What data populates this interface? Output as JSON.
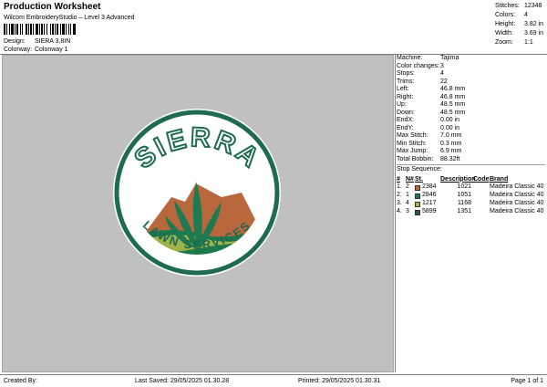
{
  "header": {
    "title": "Production Worksheet",
    "subtitle": "Wilcom EmbroideryStudio – Level 3 Advanced",
    "design_label": "Design:",
    "design_value": "SIERA 3,8IN",
    "colorway_label": "Colorway:",
    "colorway_value": "Colonway 1"
  },
  "stats": [
    {
      "k": "Stitches:",
      "v": "12348"
    },
    {
      "k": "Colors:",
      "v": "4"
    },
    {
      "k": "Height:",
      "v": "3.82 in"
    },
    {
      "k": "Width:",
      "v": "3.69 in"
    },
    {
      "k": "Zoom:",
      "v": "1:1"
    }
  ],
  "machine_info": [
    {
      "k": "Machine:",
      "v": "Tajima"
    },
    {
      "k": "Color changes:",
      "v": "3"
    },
    {
      "k": "Stops:",
      "v": "4"
    },
    {
      "k": "Trims:",
      "v": "22"
    },
    {
      "k": "Left:",
      "v": "46.8 mm"
    },
    {
      "k": "Right:",
      "v": "46.8 mm"
    },
    {
      "k": "Up:",
      "v": "48.5 mm"
    },
    {
      "k": "Down:",
      "v": "48.5 mm"
    },
    {
      "k": "EndX:",
      "v": "0.00 in"
    },
    {
      "k": "EndY:",
      "v": "0.00 in"
    },
    {
      "k": "Max Stitch:",
      "v": "7.0 mm"
    },
    {
      "k": "Min Stitch:",
      "v": "0.3 mm"
    },
    {
      "k": "Max Jump:",
      "v": "6.9 mm"
    },
    {
      "k": "Total Bobbin:",
      "v": "88.32ft"
    }
  ],
  "stop_sequence": {
    "title": "Stop Sequence:",
    "headers": [
      "#",
      "N#",
      "St.",
      "Description",
      "Code",
      "Brand"
    ],
    "rows": [
      {
        "num": "1.",
        "n": "2",
        "color": "#b9683d",
        "desc": "2384",
        "code": "1021",
        "brand": "Madeira Classic 40"
      },
      {
        "num": "2.",
        "n": "1",
        "color": "#1d7a4e",
        "desc": "2846",
        "code": "1051",
        "brand": "Madeira Classic 40"
      },
      {
        "num": "3.",
        "n": "4",
        "color": "#9fb34a",
        "desc": "1217",
        "code": "1168",
        "brand": "Madeira Classic 40"
      },
      {
        "num": "4.",
        "n": "3",
        "color": "#1e5e49",
        "desc": "5899",
        "code": "1351",
        "brand": "Madeira Classic 40"
      }
    ]
  },
  "design": {
    "logo_top_text": "SIERRA",
    "logo_bottom_text": "LAWN SERVICES",
    "colors": {
      "background": "#c0c0c0",
      "ring_green": "#1e6b4f",
      "badge_fill": "#ffffff",
      "mountain": "#b9683d",
      "hill_light": "#9fb34a",
      "hill_dark": "#1d7a4e",
      "leaf": "#1e7a50"
    }
  },
  "footer": {
    "created_by": "Created By:",
    "last_saved": "Last Saved: 29/05/2025 01.30.28",
    "printed": "Printed: 29/05/2025 01.30.31",
    "page": "Page 1 of 1"
  }
}
